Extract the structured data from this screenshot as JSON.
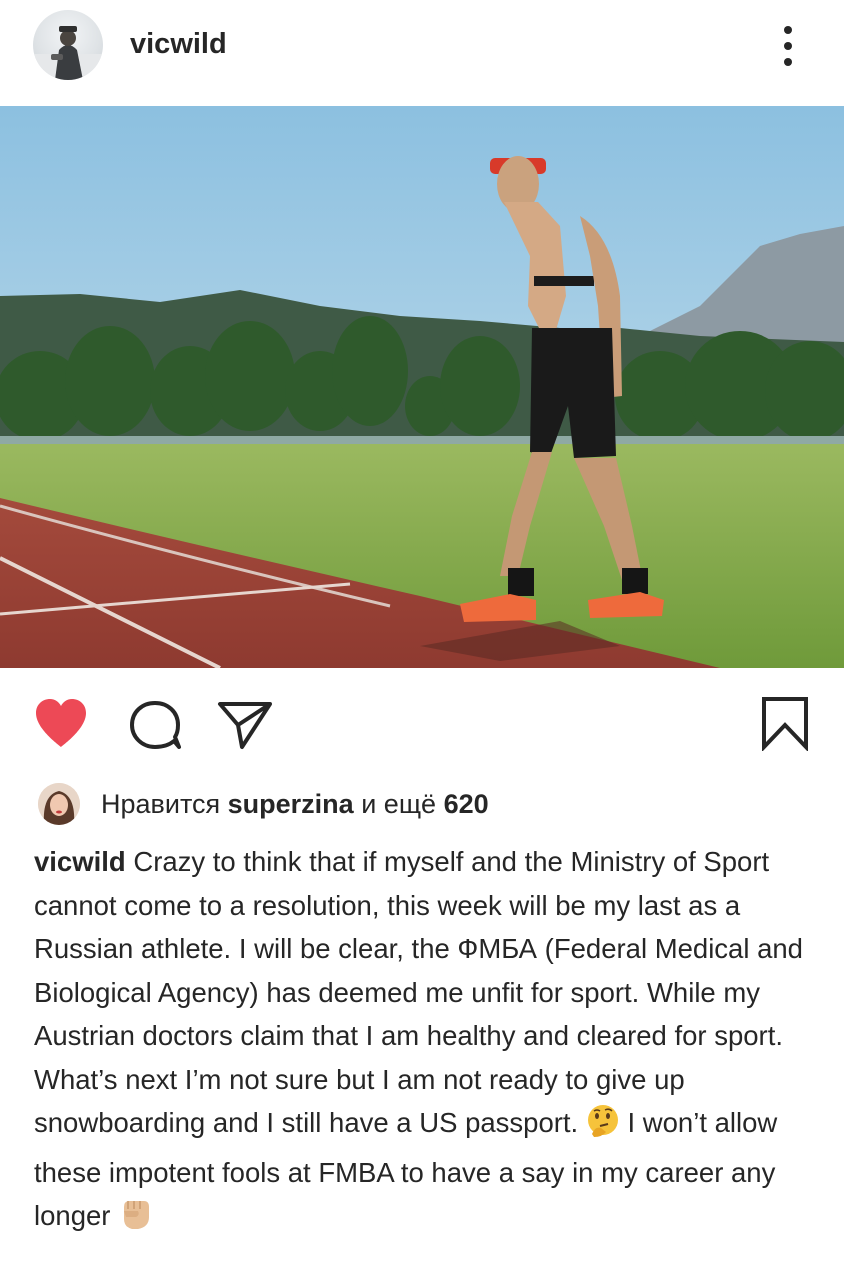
{
  "post": {
    "username": "vicwild",
    "photo_alt": ""
  },
  "likes": {
    "prefix": "Нравится",
    "user": "superzina",
    "middle": "и ещё",
    "count": "620"
  },
  "caption": {
    "username": "vicwild",
    "text_part1": "Crazy to think that if myself and the Ministry of Sport cannot come to a resolution, this week will be my last as a Russian athlete. I will be clear, the ФМБА (Federal Medical and Biological Agency) has deemed me unfit for sport. While my Austrian doctors claim that I am healthy and cleared for sport. What’s next I’m not sure but I am not ready to give up snowboarding and I still have a US passport.",
    "text_part2": "I won’t allow these impotent fools at FMBA to have a say in my career any longer"
  },
  "icons": {
    "options": "kebab-menu-icon",
    "like": "heart-icon",
    "comment": "comment-bubble-icon",
    "share": "send-icon",
    "save": "bookmark-icon",
    "emoji1": "thinking-face-emoji",
    "emoji2": "raised-fist-emoji"
  },
  "colors": {
    "like_active": "#ed4956",
    "text": "#262626"
  }
}
